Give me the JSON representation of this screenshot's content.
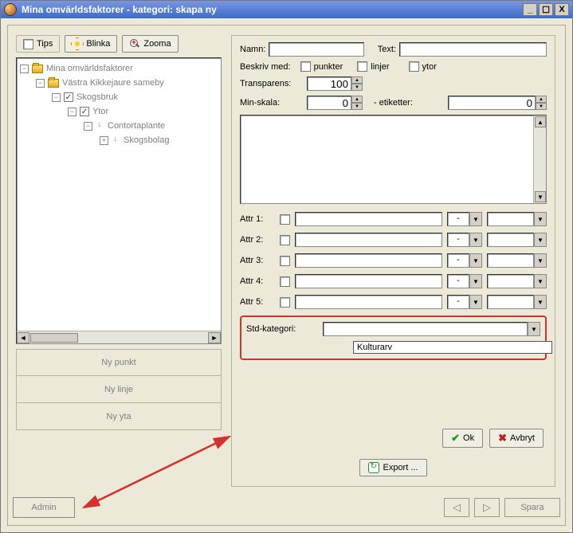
{
  "window": {
    "title": "Mina omvärldsfaktorer - kategori: skapa ny",
    "sys": {
      "min": "_",
      "max": "☐",
      "close": "X"
    }
  },
  "toolbar": {
    "tips_label": "Tips",
    "blinka_label": "Blinka",
    "zooma_label": "Zooma"
  },
  "tree": {
    "n0": "Mina omvärldsfaktorer",
    "n1": "Västra Kikkejaure sameby",
    "n2": "Skogsbruk",
    "n3": "Ytor",
    "n4": "Contortaplante",
    "n5": "Skogsbolag",
    "toggle_minus": "−",
    "toggle_plus": "+",
    "check": "✓",
    "scroll_left": "◄",
    "scroll_right": "►"
  },
  "newbtns": {
    "punkt": "Ny punkt",
    "linje": "Ny linje",
    "yta": "Ny yta"
  },
  "form": {
    "namn_label": "Namn:",
    "namn_value": "",
    "text_label": "Text:",
    "text_value": "",
    "beskriv_label": "Beskriv med:",
    "punkter_label": "punkter",
    "linjer_label": "linjer",
    "ytor_label": "ytor",
    "transparens_label": "Transparens:",
    "transparens_value": "100",
    "minskala_label": "Min-skala:",
    "minskala_value": "0",
    "etiketter_label": "- etiketter:",
    "etiketter_value": "0",
    "desc_value": ""
  },
  "attrs": {
    "a1": "Attr 1:",
    "a2": "Attr 2:",
    "a3": "Attr 3:",
    "a4": "Attr 4:",
    "a5": "Attr 5:",
    "dash": "-"
  },
  "std": {
    "label": "Std-kategori:",
    "value": "",
    "option1": "Kulturarv"
  },
  "buttons": {
    "ok": "Ok",
    "avbryt": "Avbryt",
    "export": "Export ..."
  },
  "bottom": {
    "admin": "Admin",
    "prev": "◁",
    "next": "▷",
    "spara": "Spara"
  },
  "spin": {
    "up": "▲",
    "down": "▼"
  },
  "scroll": {
    "up": "▲",
    "down": "▼"
  }
}
